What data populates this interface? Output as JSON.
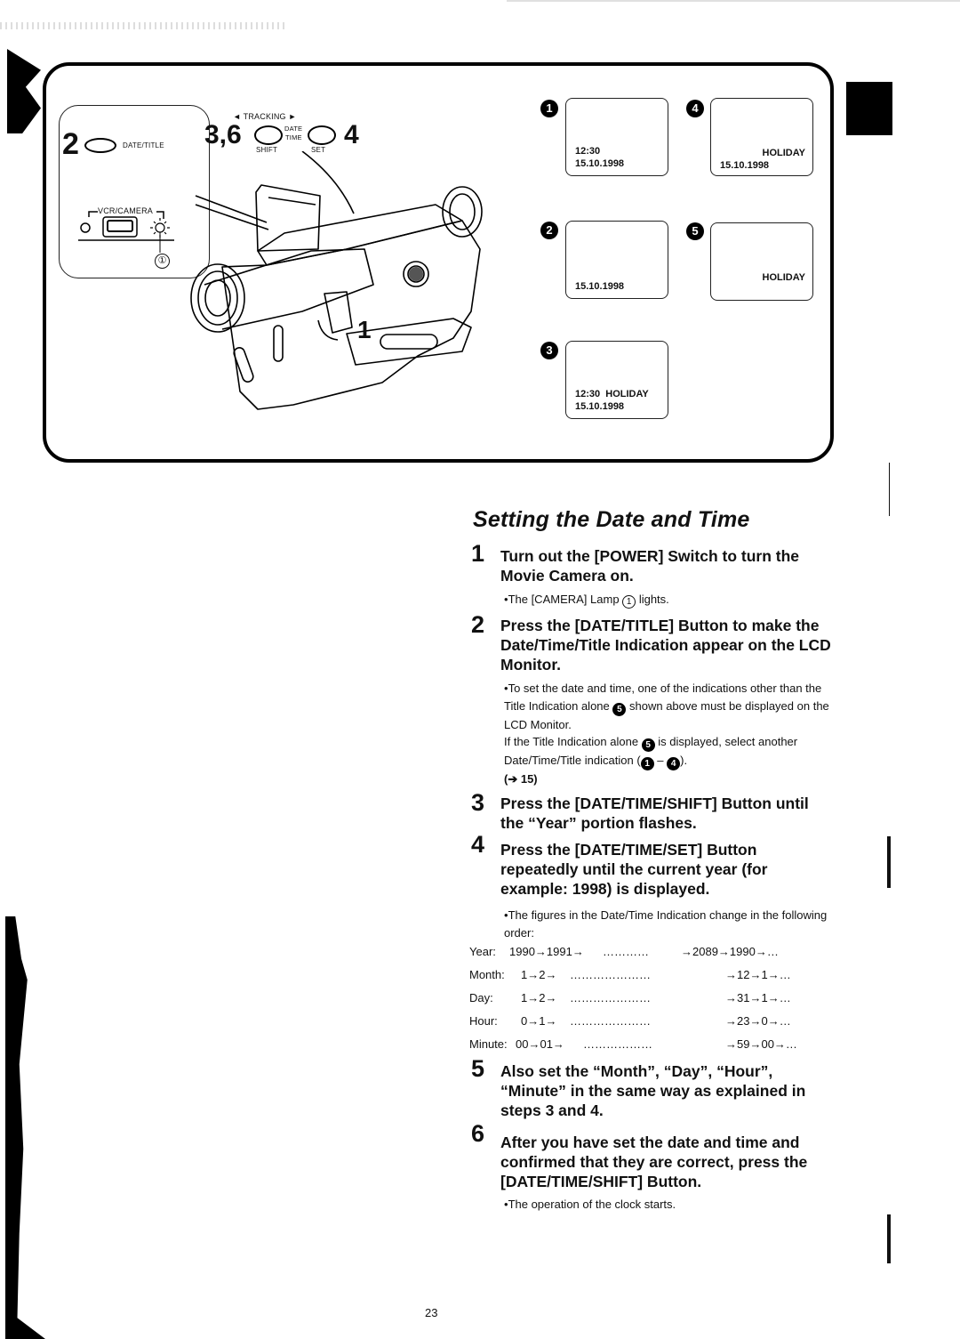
{
  "figure": {
    "inset": {
      "step_label": "2",
      "button_label": "DATE/TITLE",
      "switch_label": "VCR/CAMERA",
      "lamp_callout": "①"
    },
    "top_controls": {
      "step_left": "3,6",
      "step_right": "4",
      "tracking_label": "◄ TRACKING ►",
      "center_label_1": "DATE",
      "center_label_2": "TIME",
      "left_button_label": "SHIFT",
      "right_button_label": "SET"
    },
    "camera_step_label": "1",
    "displays": [
      {
        "marker": "1",
        "lines": [
          "12:30",
          "15.10.1998"
        ]
      },
      {
        "marker": "2",
        "lines": [
          "",
          "15.10.1998"
        ]
      },
      {
        "marker": "3",
        "lines": [
          "12:30  HOLIDAY",
          "15.10.1998"
        ]
      },
      {
        "marker": "4",
        "lines": [
          "HOLIDAY",
          "15.10.1998"
        ]
      },
      {
        "marker": "5",
        "lines": [
          "HOLIDAY"
        ]
      }
    ]
  },
  "section": {
    "title": "Setting the Date and Time",
    "steps": [
      {
        "num": "1",
        "text": "Turn out the [POWER] Switch to turn the Movie Camera on.",
        "note": "The [CAMERA] Lamp",
        "note_circled": "1",
        "note_end": "lights."
      },
      {
        "num": "2",
        "text": "Press the [DATE/TITLE] Button to make the Date/Time/Title Indication appear on the LCD Monitor.",
        "note_a": "To set the date and time, one of the indications other than the Title Indication alone",
        "note_a_marker": "5",
        "note_b": "shown above must be displayed on the LCD Monitor.",
        "note_c": "If the Title Indication alone",
        "note_c_marker": "5",
        "note_d": "is displayed, select another Date/Time/Title indication (",
        "range_start": "1",
        "range_sep": " – ",
        "range_end": "4",
        "note_e": ").",
        "ref": "(➔ 15)"
      },
      {
        "num": "3",
        "text": "Press the [DATE/TIME/SHIFT] Button until the “Year” portion flashes."
      },
      {
        "num": "4",
        "text": "Press the [DATE/TIME/SET] Button repeatedly until the current year (for example: 1998) is displayed.",
        "note": "The figures in the Date/Time Indication change in the following order:"
      },
      {
        "num": "5",
        "text": "Also set the “Month”, “Day”, “Hour”, “Minute” in the same way as explained in steps 3 and 4."
      },
      {
        "num": "6",
        "text": "After you have set the date and time and confirmed that they are correct, press the [DATE/TIME/SHIFT] Button.",
        "note": "The operation of the clock starts."
      }
    ],
    "sequence": [
      {
        "label": "Year:",
        "start": "1990→1991→",
        "dots": "…………",
        "end": "→2089→1990→…"
      },
      {
        "label": "Month:",
        "start": "1→2→",
        "dots": "…………………",
        "end": "→12→1→…"
      },
      {
        "label": "Day:",
        "start": "1→2→",
        "dots": "…………………",
        "end": "→31→1→…"
      },
      {
        "label": "Hour:",
        "start": "0→1→",
        "dots": "…………………",
        "end": "→23→0→…"
      },
      {
        "label": "Minute:",
        "start": "00→01→",
        "dots": "………………",
        "end": "→59→00→…"
      }
    ]
  },
  "page_number": "23"
}
